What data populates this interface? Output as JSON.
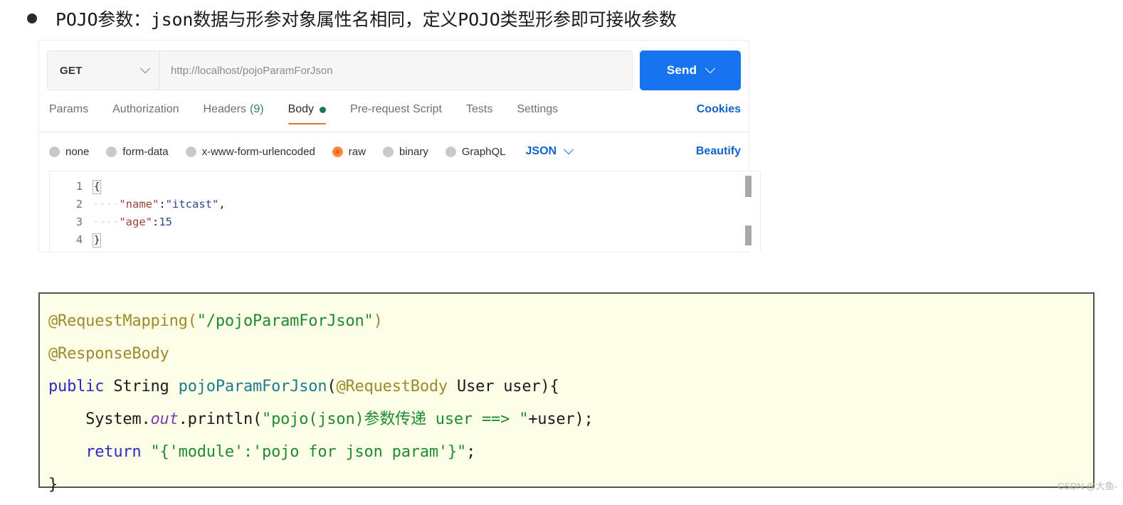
{
  "heading": {
    "bullet": "●",
    "text": "POJO参数：json数据与形参对象属性名相同，定义POJO类型形参即可接收参数"
  },
  "postman": {
    "method": "GET",
    "url": "http://localhost/pojoParamForJson",
    "send_label": "Send",
    "tabs": [
      {
        "label": "Params",
        "active": false
      },
      {
        "label": "Authorization",
        "active": false
      },
      {
        "label": "Headers",
        "count": "(9)",
        "active": false
      },
      {
        "label": "Body",
        "active": true,
        "dot": true
      },
      {
        "label": "Pre-request Script",
        "active": false
      },
      {
        "label": "Tests",
        "active": false
      },
      {
        "label": "Settings",
        "active": false
      }
    ],
    "cookies_label": "Cookies",
    "body_types": [
      {
        "label": "none",
        "selected": false
      },
      {
        "label": "form-data",
        "selected": false
      },
      {
        "label": "x-www-form-urlencoded",
        "selected": false
      },
      {
        "label": "raw",
        "selected": true
      },
      {
        "label": "binary",
        "selected": false
      },
      {
        "label": "GraphQL",
        "selected": false
      }
    ],
    "format_label": "JSON",
    "beautify_label": "Beautify",
    "editor": {
      "line_numbers": [
        "1",
        "2",
        "3",
        "4"
      ],
      "line1_brace": "{",
      "line2_indent": "····",
      "line2_key": "\"name\"",
      "line2_colon": ":",
      "line2_value": "\"itcast\"",
      "line2_comma": ",",
      "line3_indent": "····",
      "line3_key": "\"age\"",
      "line3_colon": ":",
      "line3_value": "15",
      "line4_brace": "}"
    }
  },
  "codeblock": {
    "line1_anno": "@RequestMapping(",
    "line1_str": "\"/pojoParamForJson\"",
    "line1_end": ")",
    "line2": "@ResponseBody",
    "line3_kw": "public",
    "line3_type": " String ",
    "line3_method": "pojoParamForJson",
    "line3_paren": "(",
    "line3_anno": "@RequestBody",
    "line3_args": " User user){",
    "line4_pre": "    System.",
    "line4_field": "out",
    "line4_mid": ".println(",
    "line4_str": "\"pojo(json)参数传递 user ==> \"",
    "line4_end": "+user);",
    "line5_indent": "    ",
    "line5_kw": "return",
    "line5_str": " \"{'module':'pojo for json param'}\"",
    "line5_end": ";",
    "line6": "}"
  },
  "watermark": "CSDN @大鱼-",
  "colors": {
    "send_blue": "#1774ef",
    "link_blue": "#1162c9",
    "active_tab_underline": "#e4712d",
    "raw_radio_orange": "#f4631e",
    "body_dot_green": "#1e7a4a",
    "code_bg": "#fdfde8",
    "code_border": "#55544b"
  }
}
